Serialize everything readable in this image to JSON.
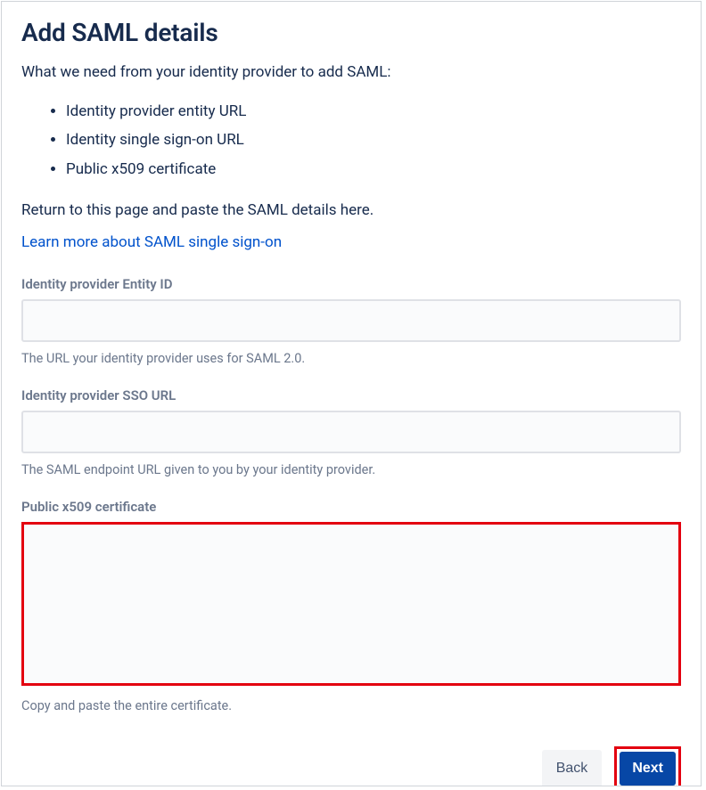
{
  "heading": "Add SAML details",
  "intro": "What we need from your identity provider to add SAML:",
  "bullets": [
    "Identity provider entity URL",
    "Identity single sign-on URL",
    "Public x509 certificate"
  ],
  "return_text": "Return to this page and paste the SAML details here.",
  "learn_more": "Learn more about SAML single sign-on",
  "fields": {
    "entity_id": {
      "label": "Identity provider Entity ID",
      "value": "",
      "help": "The URL your identity provider uses for SAML 2.0."
    },
    "sso_url": {
      "label": "Identity provider SSO URL",
      "value": "",
      "help": "The SAML endpoint URL given to you by your identity provider."
    },
    "cert": {
      "label": "Public x509 certificate",
      "value": "",
      "help": "Copy and paste the entire certificate."
    }
  },
  "buttons": {
    "back": "Back",
    "next": "Next"
  }
}
